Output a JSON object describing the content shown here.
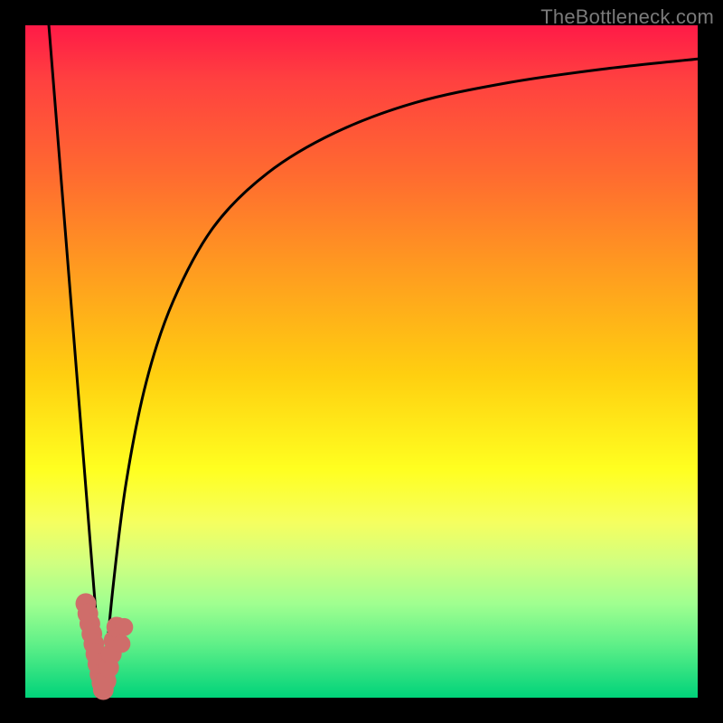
{
  "watermark": "TheBottleneck.com",
  "colors": {
    "frame": "#000000",
    "curve": "#000000",
    "points_fill": "#cf6d6a",
    "points_stroke": "#b85a57"
  },
  "chart_data": {
    "type": "line",
    "title": "",
    "xlabel": "",
    "ylabel": "",
    "xlim": [
      0,
      100
    ],
    "ylim": [
      0,
      100
    ],
    "note": "No axis ticks or numeric labels are visible in the source image; numeric values are estimated from pixel positions on a 0–100 normalized scale.",
    "series": [
      {
        "name": "left-branch",
        "stroke": "#000000",
        "x": [
          3.5,
          11.5
        ],
        "y": [
          100,
          0
        ]
      },
      {
        "name": "right-branch",
        "stroke": "#000000",
        "x": [
          11.5,
          13,
          15,
          18,
          22,
          28,
          36,
          46,
          58,
          72,
          86,
          100
        ],
        "y": [
          0,
          16,
          32,
          47,
          59,
          70,
          78,
          84,
          88.5,
          91.5,
          93.5,
          95
        ]
      }
    ],
    "scatter": [
      {
        "name": "cluster",
        "fill": "#cf6d6a",
        "points": [
          {
            "x": 9.0,
            "y": 14.0,
            "r": 1.0
          },
          {
            "x": 9.3,
            "y": 12.5,
            "r": 1.0
          },
          {
            "x": 9.6,
            "y": 11.0,
            "r": 1.0
          },
          {
            "x": 9.9,
            "y": 9.5,
            "r": 1.0
          },
          {
            "x": 10.2,
            "y": 8.0,
            "r": 1.0
          },
          {
            "x": 10.5,
            "y": 6.5,
            "r": 1.0
          },
          {
            "x": 10.8,
            "y": 5.0,
            "r": 1.0
          },
          {
            "x": 11.1,
            "y": 3.5,
            "r": 1.0
          },
          {
            "x": 11.4,
            "y": 2.2,
            "r": 1.0
          },
          {
            "x": 11.6,
            "y": 1.2,
            "r": 1.0
          },
          {
            "x": 12.0,
            "y": 2.5,
            "r": 1.0
          },
          {
            "x": 12.4,
            "y": 4.5,
            "r": 1.0
          },
          {
            "x": 12.8,
            "y": 6.5,
            "r": 1.0
          },
          {
            "x": 13.2,
            "y": 8.5,
            "r": 1.0
          },
          {
            "x": 13.6,
            "y": 10.5,
            "r": 1.0
          },
          {
            "x": 14.3,
            "y": 8.0,
            "r": 0.8
          },
          {
            "x": 14.7,
            "y": 10.5,
            "r": 0.8
          }
        ]
      }
    ]
  }
}
